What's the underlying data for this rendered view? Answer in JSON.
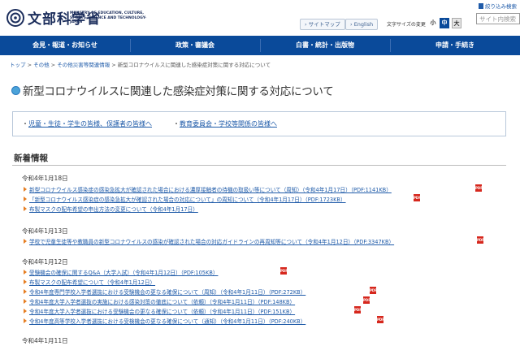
{
  "header": {
    "logo_jp": "文部科学省",
    "logo_en": "MINISTRY OF EDUCATION, CULTURE, SPORTS, SCIENCE AND TECHNOLOGY-JAPAN",
    "sitemap": "サイトマップ",
    "english": "English",
    "font_size_label": "文字サイズの変更",
    "font_small": "小",
    "font_medium": "中",
    "font_large": "大",
    "register_link": "絞り込み検索",
    "search_placeholder": "サイト内検索"
  },
  "nav": {
    "items": [
      "会見・報道・お知らせ",
      "政策・審議会",
      "白書・統計・出版物",
      "申請・手続き"
    ]
  },
  "breadcrumb": [
    "トップ",
    "その他",
    "その他災害等関連情報",
    "新型コロナウイルスに関連した感染症対策に関する対応について"
  ],
  "page_title": "新型コロナウイルスに関連した感染症対策に関する対応について",
  "audience_links": [
    "児童・生徒・学生の皆様、保護者の皆様へ",
    "教育委員会・学校等関係の皆様へ"
  ],
  "section_title": "新着情報",
  "news": [
    {
      "date": "令和4年1月18日",
      "items": [
        "新型コロナウイルス感染症の感染急拡大が確認された場合における濃厚接触者の待機の取扱い等について（周知）（令和4年1月17日）（PDF:1141KB）",
        "「新型コロナウイルス感染症の感染急拡大が確認された場合の対応について」の周知について（令和4年1月17日）（PDF:1723KB）",
        "布製マスクの配布希望の申出方法の変更について（令和4年1月17日）"
      ],
      "pdf": [
        true,
        true,
        false
      ]
    },
    {
      "date": "令和4年1月13日",
      "items": [
        "学校で児童生徒等や教職員の新型コロナウイルスの感染が確認された場合の対応ガイドラインの再周知等について（令和4年1月12日）（PDF:3347KB）"
      ],
      "pdf": [
        true
      ]
    },
    {
      "date": "令和4年1月12日",
      "items": [
        "受験機会の確保に関するQ&A（大学入試）（令和4年1月12日）（PDF:105KB）",
        "布製マスクの配布希望について（令和4年1月12日）",
        "令和4年度専門学校入学者選抜における受験機会の更なる確保について（周知）（令和4年1月11日）（PDF:272KB）",
        "令和4年度大学入学者選抜の実施における感染対策の徹底について（依頼）（令和4年1月11日）（PDF:148KB）",
        "令和4年度大学入学者選抜における受験機会の更なる確保について（依頼）（令和4年1月11日）（PDF:151KB）",
        "令和4年度高等学校入学者選抜における受検機会の更なる確保について（通知）（令和4年1月11日）（PDF:240KB）"
      ],
      "pdf": [
        true,
        false,
        true,
        true,
        true,
        true
      ]
    },
    {
      "date": "令和4年1月11日",
      "items": [],
      "pdf": []
    }
  ],
  "pdf_label": "PDF",
  "colors": {
    "nav_bg": "#0a4a9a",
    "link": "#1f5ba9",
    "pdf_red": "#d6271d",
    "logo": "#1c2e5c"
  }
}
